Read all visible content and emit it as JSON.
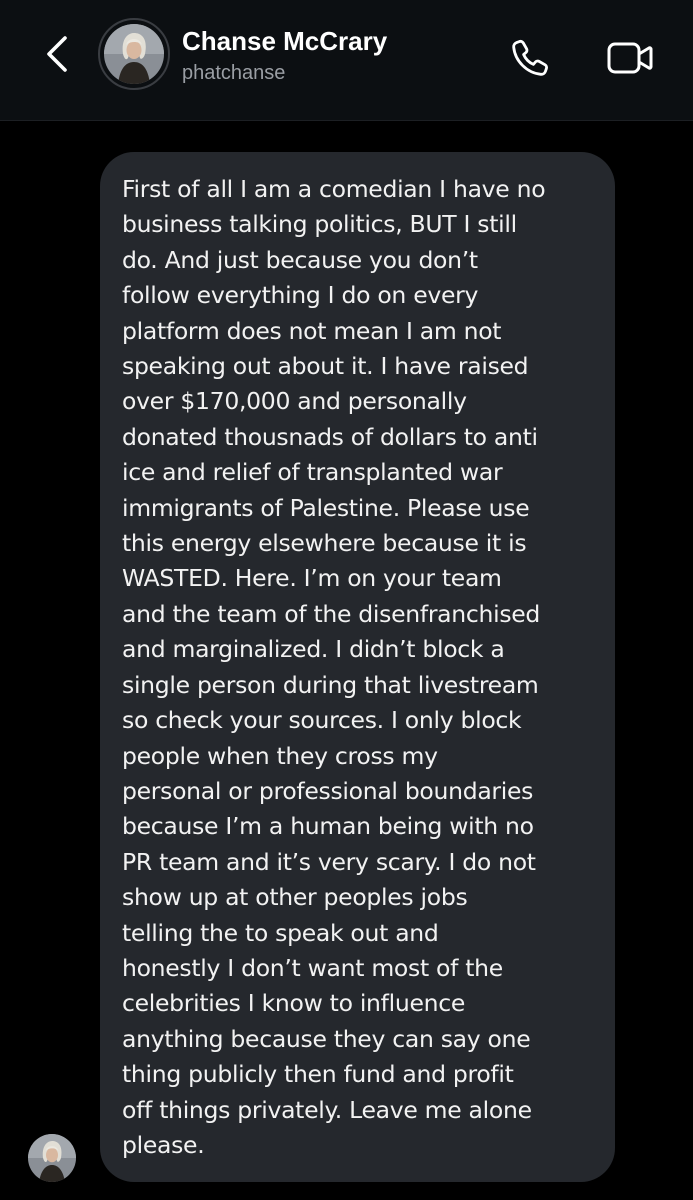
{
  "header": {
    "back_icon": "chevron-left-icon",
    "contact_name": "Chanse McCrary",
    "contact_handle": "phatchanse",
    "call_icon": "phone-icon",
    "video_icon": "video-camera-icon"
  },
  "colors": {
    "header_bg": "#0c0f12",
    "thread_bg": "#000000",
    "bubble_bg": "#25282d",
    "text_primary": "#ffffff",
    "text_secondary": "#9a9ea4"
  },
  "message": {
    "lines": [
      "First of all I am a comedian I have no",
      "business talking politics, BUT I still",
      "do. And just because you don’t",
      "follow everything I do on every",
      "platform does not mean I am not",
      "speaking out about it. I have raised",
      "over $170,000 and personally",
      "donated thousnads of dollars to anti",
      "ice and relief of transplanted war",
      "immigrants of Palestine. Please use",
      "this energy elsewhere because it is",
      "WASTED. Here. I’m on your team",
      "and the team of the disenfranchised",
      "and marginalized. I didn’t block a",
      "single person during that livestream",
      "so check your sources. I only block",
      "people when they cross my",
      "personal or professional boundaries",
      "because I’m a human being with no",
      "PR team and it’s very scary. I do not",
      "show up at other peoples jobs",
      "telling the to speak out and",
      "honestly I don’t want most of the",
      "celebrities I know to influence",
      "anything because they can say one",
      "thing publicly then fund and profit",
      "off things privately. Leave me alone",
      "please."
    ]
  }
}
